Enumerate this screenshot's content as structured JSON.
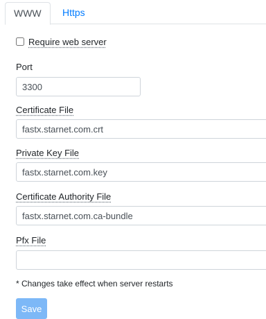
{
  "tabs": [
    {
      "label": "WWW",
      "active": true
    },
    {
      "label": "Https",
      "active": false
    }
  ],
  "require_web_server": {
    "label": "Require web server",
    "checked": false
  },
  "port": {
    "label": "Port",
    "value": "3300"
  },
  "certificate_file": {
    "label": "Certificate File",
    "value": "fastx.starnet.com.crt"
  },
  "private_key_file": {
    "label": "Private Key File",
    "value": "fastx.starnet.com.key"
  },
  "certificate_authority_file": {
    "label": "Certificate Authority File",
    "value": "fastx.starnet.com.ca-bundle"
  },
  "pfx_file": {
    "label": "Pfx File",
    "value": ""
  },
  "note": "* Changes take effect when server restarts",
  "save_label": "Save",
  "colors": {
    "link": "#007bff",
    "save_button_disabled": "#7db8f7",
    "border": "#ced4da"
  }
}
